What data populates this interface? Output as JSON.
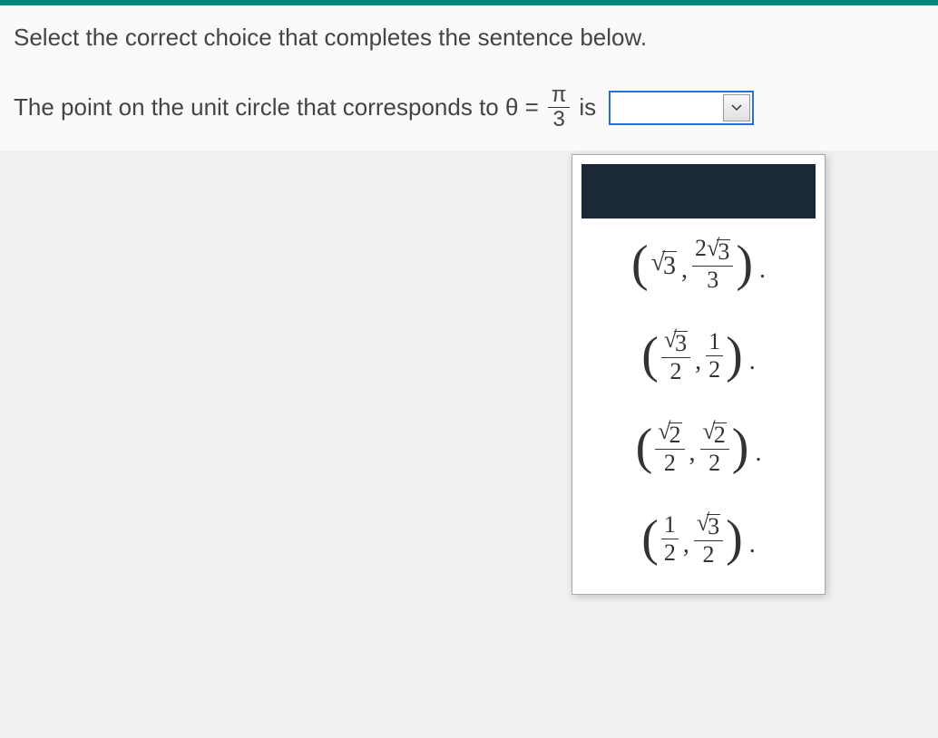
{
  "instruction": "Select the correct choice that completes the sentence below.",
  "question": {
    "prefix": "The point on the unit circle that corresponds to θ =",
    "frac_num": "π",
    "frac_den": "3",
    "suffix": "is"
  },
  "dropdown": {
    "selected": "",
    "options": [
      {
        "id": "blank",
        "display": ""
      },
      {
        "id": "opt1",
        "display": "(√3, 2√3/3)"
      },
      {
        "id": "opt2",
        "display": "(√3/2, 1/2)"
      },
      {
        "id": "opt3",
        "display": "(√2/2, √2/2)"
      },
      {
        "id": "opt4",
        "display": "(1/2, √3/2)"
      }
    ]
  }
}
